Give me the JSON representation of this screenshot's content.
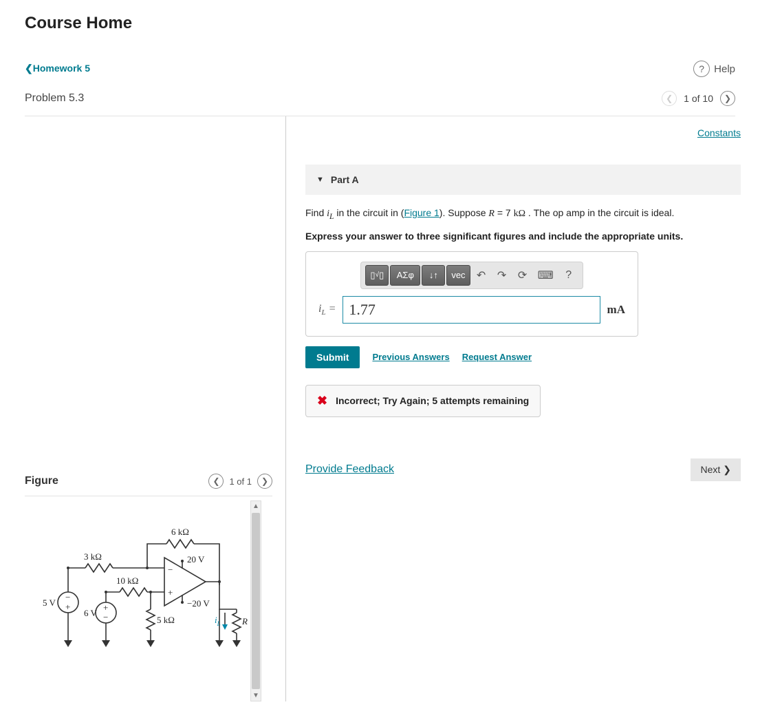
{
  "header": {
    "course_title": "Course Home",
    "breadcrumb_label": "Homework 5",
    "help_label": "Help",
    "problem_title": "Problem 5.3",
    "nav_position": "1 of 10"
  },
  "right": {
    "constants_link": "Constants",
    "part_label": "Part A",
    "question_prefix": "Find ",
    "question_var": "i",
    "question_var_sub": "L",
    "question_mid": " in the circuit in (",
    "figure_link": "Figure 1",
    "question_suffix_1": "). Suppose ",
    "question_R": "R",
    "question_eq": " = 7 ",
    "question_unit_R": "kΩ",
    "question_suffix_2": " . The op amp in the circuit is ideal.",
    "instructions": "Express your answer to three significant figures and include the appropriate units.",
    "toolbar": {
      "templates": "√",
      "greek": "ΑΣφ",
      "subsup": "↓↑",
      "vec": "vec",
      "undo": "↶",
      "redo": "↷",
      "reset": "⟳",
      "keyboard": "⌨",
      "help": "?"
    },
    "lhs_var": "i",
    "lhs_sub": "L",
    "lhs_eq": " = ",
    "answer_value": "1.77",
    "answer_unit": "mA",
    "submit_label": "Submit",
    "prev_answers_link": "Previous Answers",
    "request_answer_link": "Request Answer",
    "feedback_text": "Incorrect; Try Again; 5 attempts remaining",
    "provide_feedback_link": "Provide Feedback",
    "next_label": "Next"
  },
  "figure": {
    "title": "Figure",
    "nav_position": "1 of 1",
    "labels": {
      "r6k": "6 kΩ",
      "r3k": "3 kΩ",
      "r10k": "10 kΩ",
      "r5k": "5 kΩ",
      "v5": "5 V",
      "v6": "6 V",
      "vpos20": "20 V",
      "vneg20": "−20 V",
      "iL": "i",
      "iL_sub": "L",
      "R": "R"
    }
  }
}
